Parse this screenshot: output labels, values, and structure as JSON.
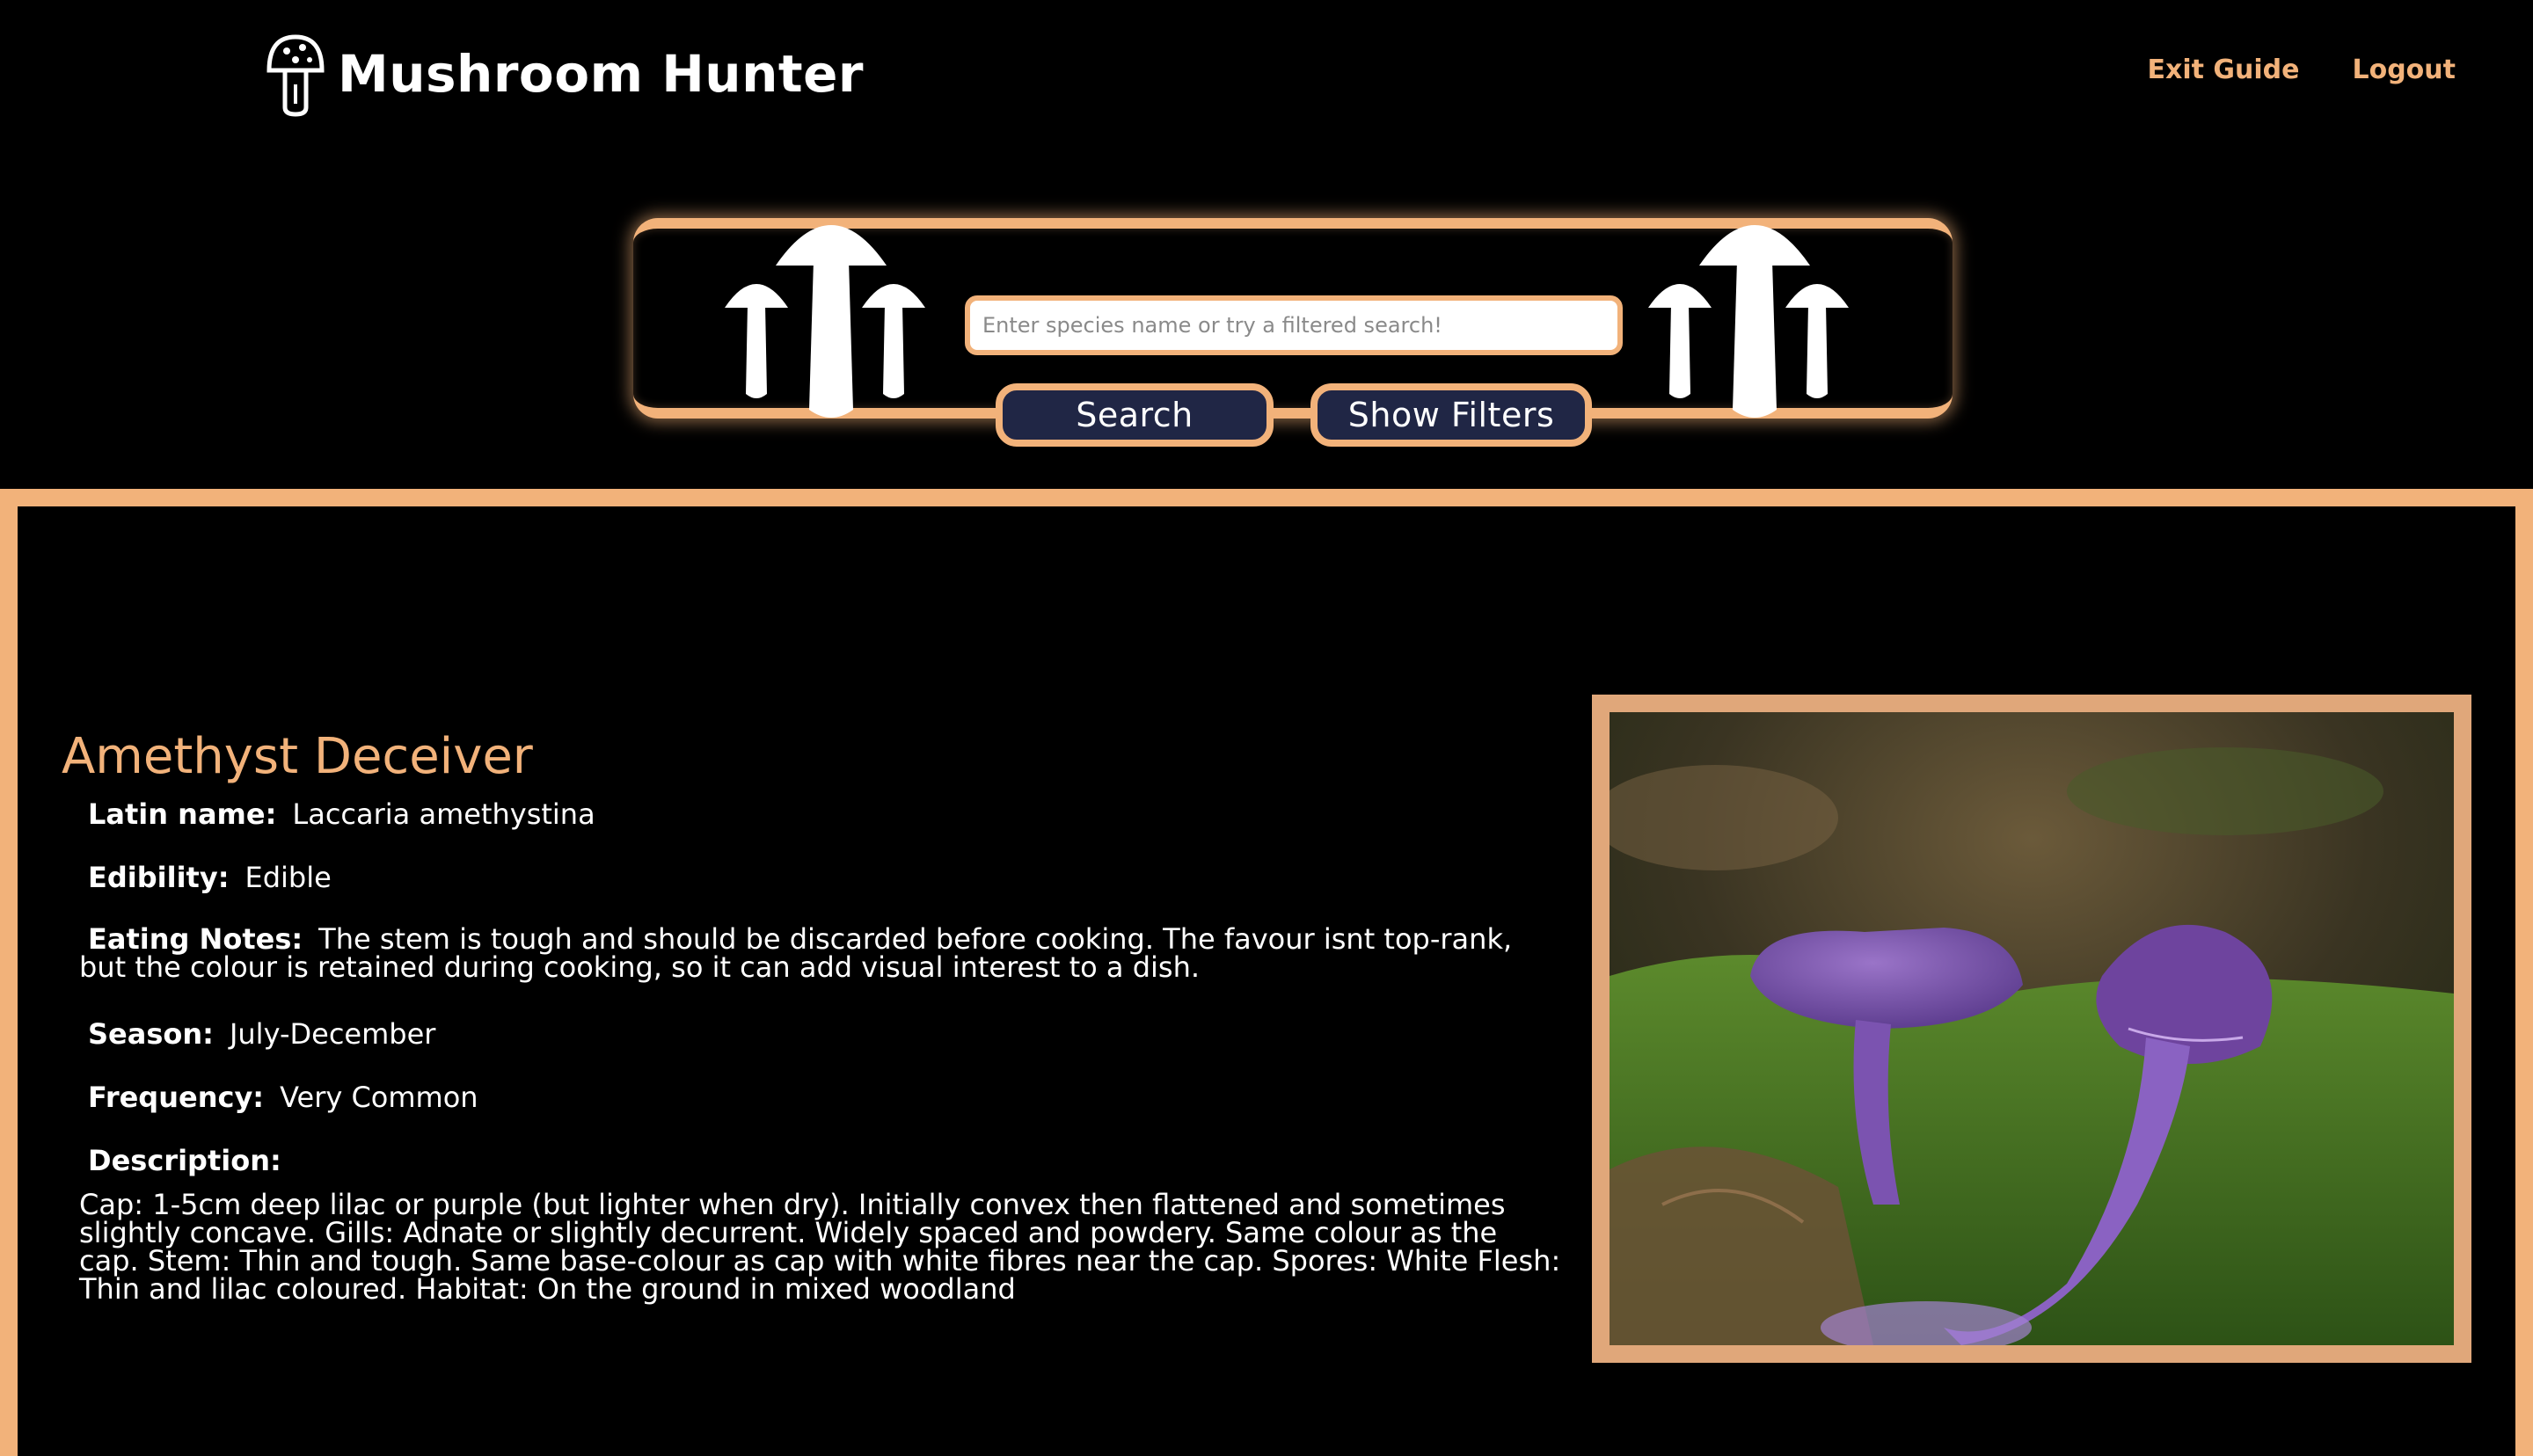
{
  "header": {
    "brand_title": "Mushroom Hunter",
    "logo_icon": "mushroom-icon",
    "nav": [
      {
        "label": "Exit Guide"
      },
      {
        "label": "Logout"
      }
    ]
  },
  "search": {
    "placeholder": "Enter species name or try a filtered search!",
    "value": "",
    "search_label": "Search",
    "filters_label": "Show Filters"
  },
  "species": {
    "name": "Amethyst Deceiver",
    "latin_label": "Latin name:",
    "latin_value": "Laccaria amethystina",
    "edibility_label": "Edibility:",
    "edibility_value": "Edible",
    "eating_label": "Eating Notes:",
    "eating_value": "The stem is tough and should be discarded before cooking. The favour isnt top-rank, but the colour is retained during cooking, so it can add visual interest to a dish.",
    "season_label": "Season:",
    "season_value": "July-December",
    "frequency_label": "Frequency:",
    "frequency_value": "Very Common",
    "description_label": "Description:",
    "description_value": "Cap: 1-5cm deep lilac or purple (but lighter when dry). Initially convex then flattened and sometimes slightly concave. Gills: Adnate or slightly decurrent. Widely spaced and powdery. Same colour as the cap. Stem: Thin and tough. Same base-colour as cap with white fibres near the cap. Spores: White Flesh: Thin and lilac coloured. Habitat: On the ground in mixed woodland"
  },
  "colors": {
    "accent": "#f2b27a",
    "button_bg": "#202645",
    "background": "#000000",
    "mushroom_purple": "#7a4fb0"
  }
}
